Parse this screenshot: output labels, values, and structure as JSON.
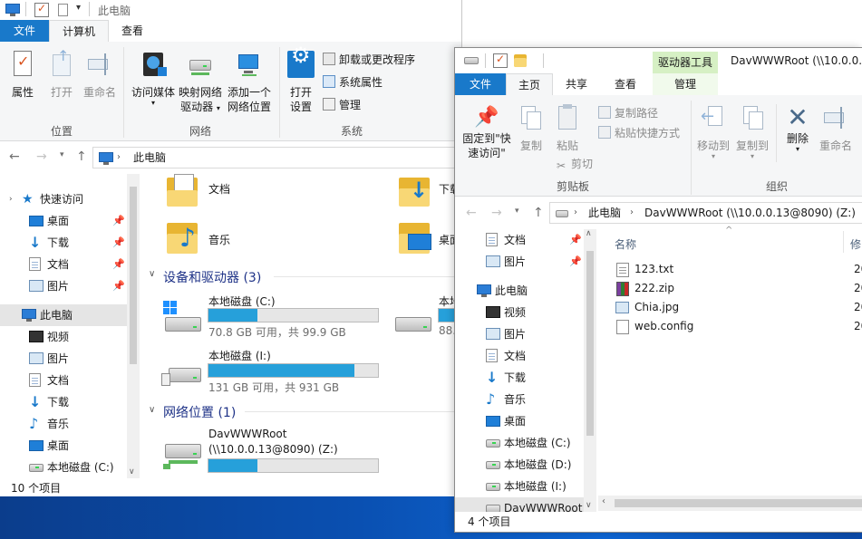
{
  "win1": {
    "title": "此电脑",
    "tabs": {
      "file": "文件",
      "computer": "计算机",
      "view": "查看"
    },
    "ribbon": {
      "properties": "属性",
      "open": "打开",
      "rename": "重命名",
      "location_group": "位置",
      "access_media": "访问媒体",
      "map_drive_l1": "映射网络",
      "map_drive_l2": "驱动器",
      "add_location_l1": "添加一个",
      "add_location_l2": "网络位置",
      "network_group": "网络",
      "open_settings_l1": "打开",
      "open_settings_l2": "设置",
      "uninstall": "卸载或更改程序",
      "system_props": "系统属性",
      "manage": "管理",
      "system_group": "系统"
    },
    "address": {
      "path": "此电脑"
    },
    "nav": {
      "quick_access": "快速访问",
      "desktop": "桌面",
      "downloads": "下载",
      "documents": "文档",
      "pictures": "图片",
      "this_pc": "此电脑",
      "videos": "视频",
      "pictures2": "图片",
      "documents2": "文档",
      "downloads2": "下载",
      "music": "音乐",
      "desktop2": "桌面",
      "local_c": "本地磁盘 (C:)"
    },
    "folders": {
      "documents": "文档",
      "downloads": "下载",
      "music": "音乐",
      "desktop": "桌面"
    },
    "devices_header": "设备和驱动器 (3)",
    "drive_c": {
      "name": "本地磁盘 (C:)",
      "free": "70.8 GB 可用，共 99.9 GB",
      "used_fraction": 0.29
    },
    "drive_d": {
      "name": "本地",
      "free": "88.",
      "used_fraction": 0.5
    },
    "drive_i": {
      "name": "本地磁盘 (I:)",
      "free": "131 GB 可用，共 931 GB",
      "used_fraction": 0.86
    },
    "network_header": "网络位置 (1)",
    "net_drive": {
      "name_l1": "DavWWWRoot",
      "name_l2": "(\\\\10.0.0.13@8090) (Z:)",
      "used_fraction": 0.29
    },
    "status": "10 个项目"
  },
  "win2": {
    "title": "DavWWWRoot (\\\\10.0.0.1",
    "context_tab": "驱动器工具",
    "tabs": {
      "file": "文件",
      "home": "主页",
      "share": "共享",
      "view": "查看",
      "manage": "管理"
    },
    "ribbon": {
      "pin_l1": "固定到\"快",
      "pin_l2": "速访问\"",
      "copy": "复制",
      "paste": "粘贴",
      "copy_path": "复制路径",
      "paste_shortcut": "粘贴快捷方式",
      "cut": "剪切",
      "clipboard_group": "剪贴板",
      "move_to": "移动到",
      "copy_to": "复制到",
      "delete": "删除",
      "rename": "重命名",
      "organize_group": "组织"
    },
    "address": {
      "seg1": "此电脑",
      "seg2": "DavWWWRoot (\\\\10.0.0.13@8090) (Z:)"
    },
    "nav": {
      "documents": "文档",
      "pictures": "图片",
      "this_pc": "此电脑",
      "videos": "视频",
      "pictures2": "图片",
      "documents2": "文档",
      "downloads": "下载",
      "music": "音乐",
      "desktop": "桌面",
      "local_c": "本地磁盘 (C:)",
      "local_d": "本地磁盘 (D:)",
      "local_i": "本地磁盘 (I:)",
      "dav": "DavWWWRoot"
    },
    "columns": {
      "name": "名称",
      "modified": "修"
    },
    "files": [
      {
        "name": "123.txt",
        "date": "20"
      },
      {
        "name": "222.zip",
        "date": "20"
      },
      {
        "name": "Chia.jpg",
        "date": "20"
      },
      {
        "name": "web.config",
        "date": "20"
      }
    ],
    "status": "4 个项目"
  }
}
